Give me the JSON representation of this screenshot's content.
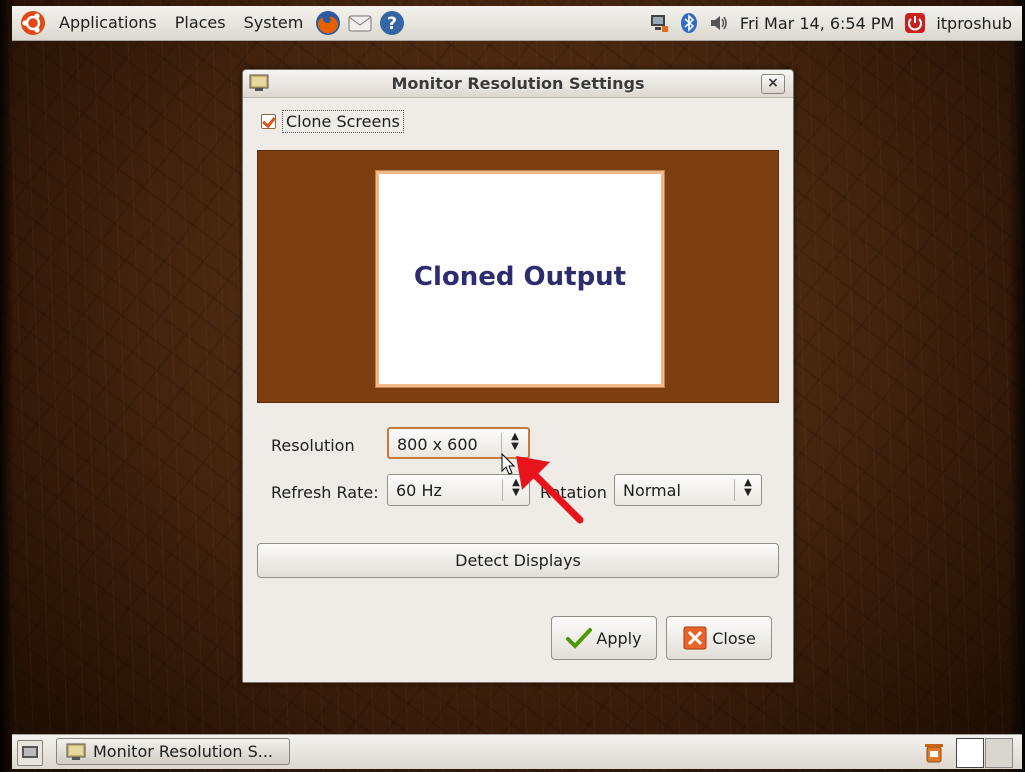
{
  "top_panel": {
    "menus": [
      "Applications",
      "Places",
      "System"
    ],
    "clock": "Fri Mar 14,  6:54 PM",
    "user": "itproshub"
  },
  "dialog": {
    "title": "Monitor Resolution Settings",
    "close_label": "×",
    "clone_checkbox_label": "Clone Screens",
    "clone_checked": true,
    "preview_label": "Cloned Output",
    "resolution_label": "Resolution",
    "resolution_value": "800 x 600",
    "refresh_label": "Refresh Rate:",
    "refresh_value": "60 Hz",
    "rotation_label": "Rotation",
    "rotation_value": "Normal",
    "detect_label": "Detect Displays",
    "apply_label": "Apply",
    "close_button_label": "Close"
  },
  "bottom_panel": {
    "task_label": "Monitor Resolution S..."
  },
  "colors": {
    "accent": "#d2571a",
    "preview_bg": "#7d3f10",
    "preview_text": "#2c2c6e",
    "panel": "#dcd8d0"
  }
}
